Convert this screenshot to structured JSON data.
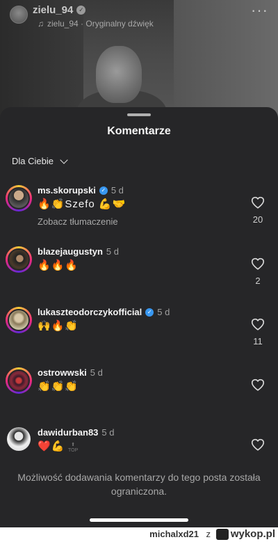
{
  "reel": {
    "username": "zielu_94",
    "verified_mark": "✓",
    "audio_label": "zielu_94 · Oryginalny dźwięk",
    "more_glyph": "···"
  },
  "sheet": {
    "title": "Komentarze",
    "sort_label": "Dla Ciebie"
  },
  "comments": [
    {
      "username": "ms.skorupski",
      "verified": true,
      "time": "5 d",
      "text": "🔥👏Szefo 💪🤝",
      "translate": "Zobacz tłumaczenie",
      "likes": "20",
      "avatar": "avatar-ms-skorupski"
    },
    {
      "username": "blazejaugustyn",
      "verified": false,
      "time": "5 d",
      "text": "🔥🔥🔥",
      "likes": "2",
      "avatar": "avatar-blazejaugustyn"
    },
    {
      "username": "lukaszteodorczykofficial",
      "verified": true,
      "time": "5 d",
      "text": "🙌🔥👏",
      "likes": "11",
      "avatar": "avatar-lukaszteodorczykofficial"
    },
    {
      "username": "ostrowwski",
      "verified": false,
      "time": "5 d",
      "text": "👏👏👏",
      "likes": "",
      "avatar": "avatar-ostrowwski"
    },
    {
      "username": "dawidurban83",
      "verified": false,
      "time": "5 d",
      "text": "❤️💪",
      "likes": "",
      "top_label": "TOP",
      "avatar": "avatar-dawidurban83"
    }
  ],
  "restricted_notice": "Możliwość dodawania komentarzy do tego posta została ograniczona.",
  "watermark": {
    "user": "michalxd21",
    "z": "z",
    "site": "wykop.pl"
  },
  "colors": {
    "sheet_bg": "#262628",
    "verified_blue": "#3897f0",
    "story_ring": [
      "#f9ce34",
      "#ee2a7b",
      "#6228d7"
    ]
  },
  "icons": [
    "music-icon",
    "verified-icon",
    "chevron-down-icon",
    "heart-icon",
    "more-icon",
    "wykop-logo-icon"
  ]
}
